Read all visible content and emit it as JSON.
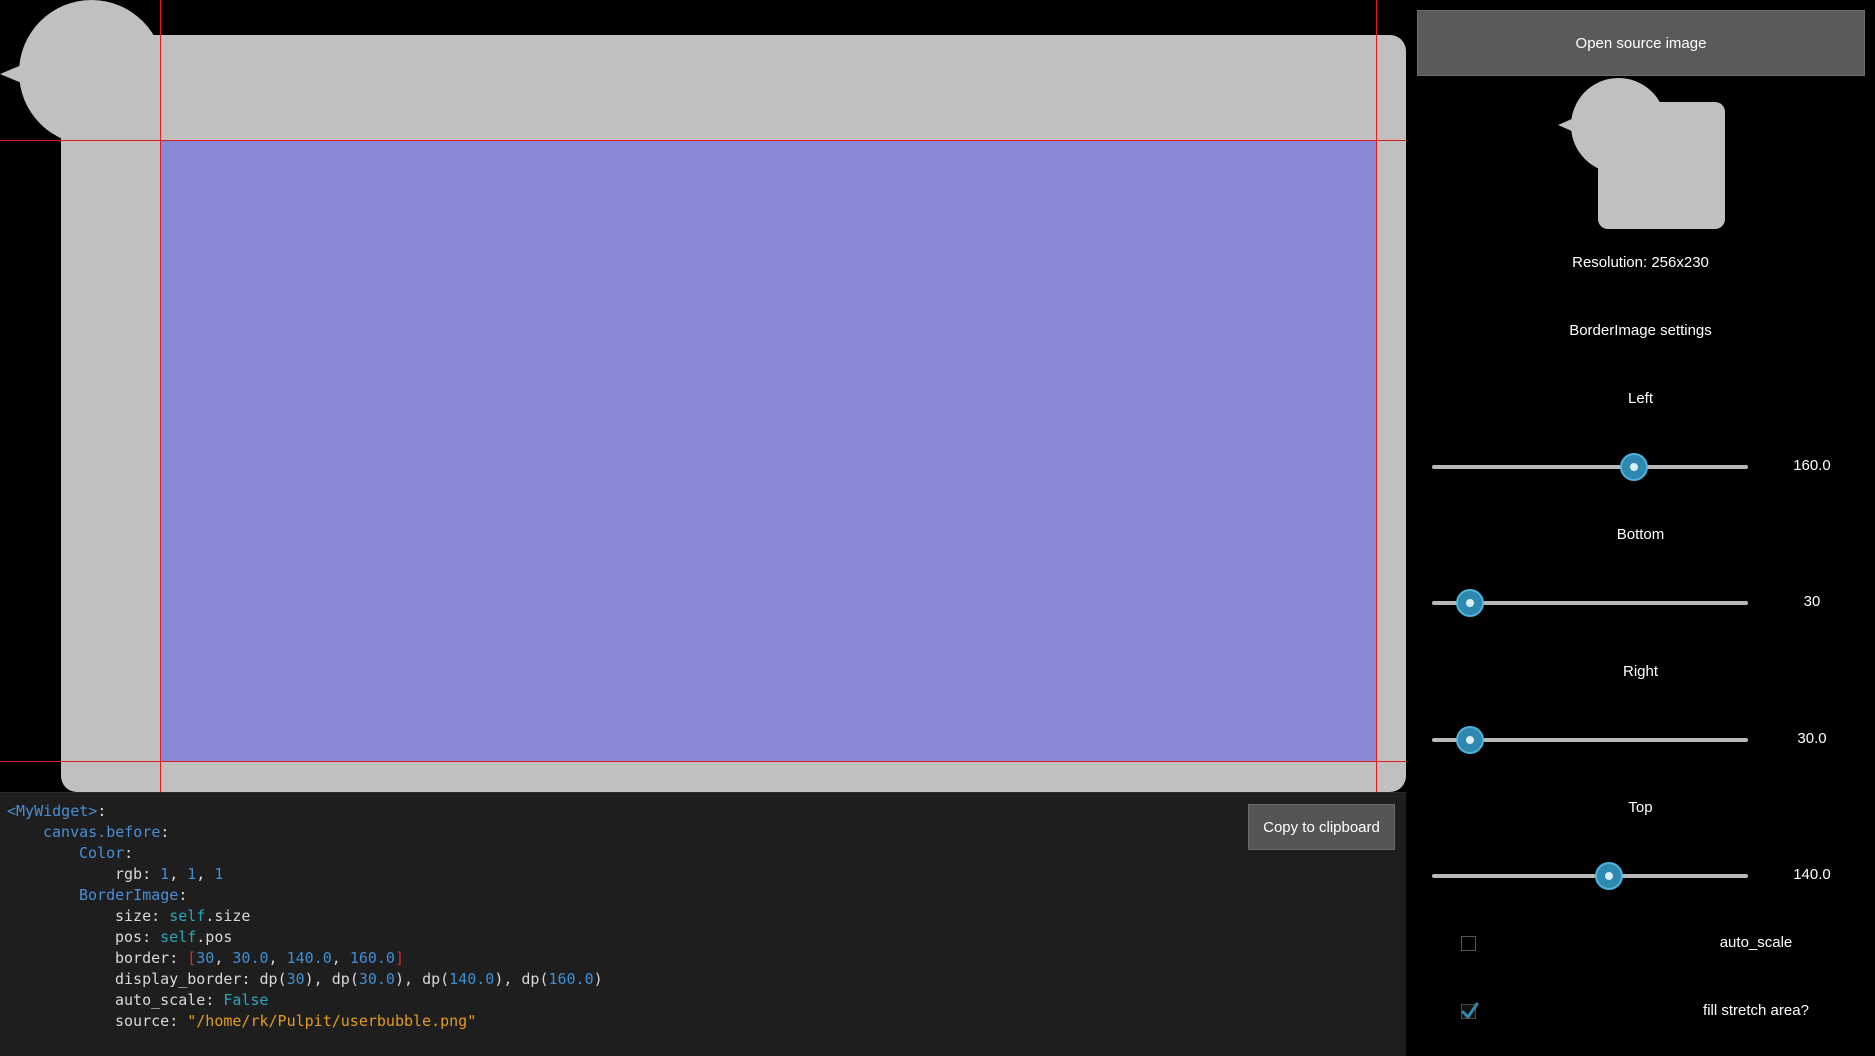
{
  "preview": {
    "fill_color": "#8888d4",
    "border_color": "#c0c0c0",
    "guide_color": "#e01c1c"
  },
  "code": {
    "widget": "<MyWidget>",
    "canvas_before": "canvas.before",
    "color": "Color",
    "rgb_key": "rgb",
    "rgb_values": [
      "1",
      "1",
      "1"
    ],
    "border_image": "BorderImage",
    "size_key": "size",
    "size_self": "self",
    "size_attr": ".size",
    "pos_key": "pos",
    "pos_self": "self",
    "pos_attr": ".pos",
    "border_key": "border",
    "border_values": [
      "30",
      "30.0",
      "140.0",
      "160.0"
    ],
    "display_border_key": "display_border",
    "display_border_func": "dp",
    "display_border_values": [
      "30",
      "30.0",
      "140.0",
      "160.0"
    ],
    "auto_scale_key": "auto_scale",
    "auto_scale_value": "False",
    "source_key": "source",
    "source_value": "\"/home/rk/Pulpit/userbubble.png\"",
    "copy_button_label": "Copy to clipboard"
  },
  "side": {
    "open_button_label": "Open source image",
    "resolution_text": "Resolution: 256x230",
    "settings_title": "BorderImage settings",
    "sliders": [
      {
        "label": "Left",
        "value": "160.0",
        "fraction": 0.64
      },
      {
        "label": "Bottom",
        "value": "30",
        "fraction": 0.12
      },
      {
        "label": "Right",
        "value": "30.0",
        "fraction": 0.12
      },
      {
        "label": "Top",
        "value": "140.0",
        "fraction": 0.56
      }
    ],
    "checkboxes": [
      {
        "label": "auto_scale",
        "checked": false
      },
      {
        "label": "fill stretch area?",
        "checked": true
      }
    ],
    "accent_color": "#2e88b0"
  }
}
